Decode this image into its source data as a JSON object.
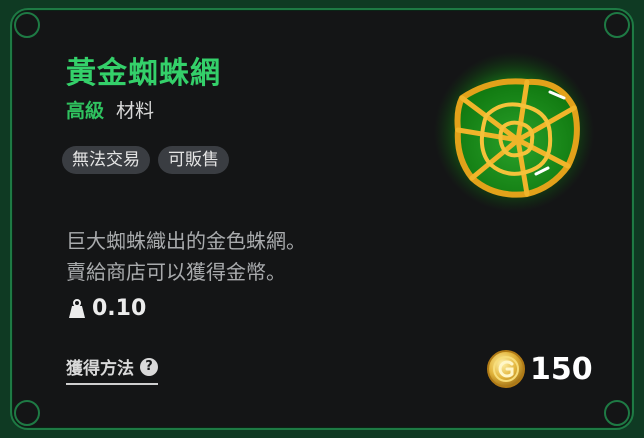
{
  "item": {
    "name": "黃金蜘蛛網",
    "grade": "高級",
    "category": "材料",
    "tags": [
      "無法交易",
      "可販售"
    ],
    "description_lines": [
      "巨大蜘蛛織出的金色蛛網。",
      "賣給商店可以獲得金幣。"
    ],
    "weight": "0.10",
    "obtain_label": "獲得方法",
    "price": "150"
  },
  "colors": {
    "title": "#34d06a",
    "grade": "#2fc25f",
    "border": "#1e7a44",
    "panel": "#141516",
    "background": "#0f3a23"
  },
  "icons": {
    "item": "golden-spider-web-icon",
    "weight": "weight-icon",
    "help": "question-circle-icon",
    "currency": "gold-coin-icon"
  }
}
